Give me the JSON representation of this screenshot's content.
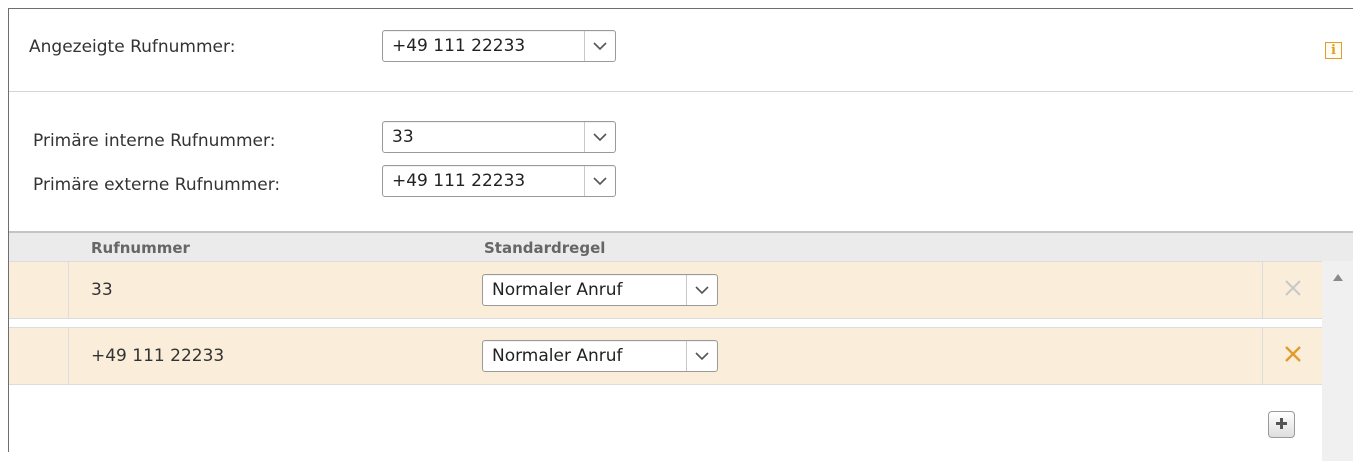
{
  "form": {
    "displayed_number_label": "Angezeigte Rufnummer:",
    "displayed_number_value": "+49 111 22233",
    "primary_internal_label": "Primäre interne Rufnummer:",
    "primary_internal_value": "33",
    "primary_external_label": "Primäre externe Rufnummer:",
    "primary_external_value": "+49 111 22233"
  },
  "table": {
    "columns": [
      "Rufnummer",
      "Standardregel"
    ],
    "rows": [
      {
        "number": "33",
        "rule": "Normaler Anruf",
        "delete_enabled": false
      },
      {
        "number": "+49 111 22233",
        "rule": "Normaler Anruf",
        "delete_enabled": true
      }
    ]
  },
  "icons": {
    "info": "info-icon",
    "dropdown": "chevron-down-icon",
    "delete": "close-icon",
    "add": "plus-icon",
    "scroll_up": "caret-up-icon"
  },
  "colors": {
    "accent_orange": "#e09c2b",
    "row_background": "#faeedb",
    "header_background": "#ebebeb",
    "disabled_icon": "#c8c8c8"
  }
}
